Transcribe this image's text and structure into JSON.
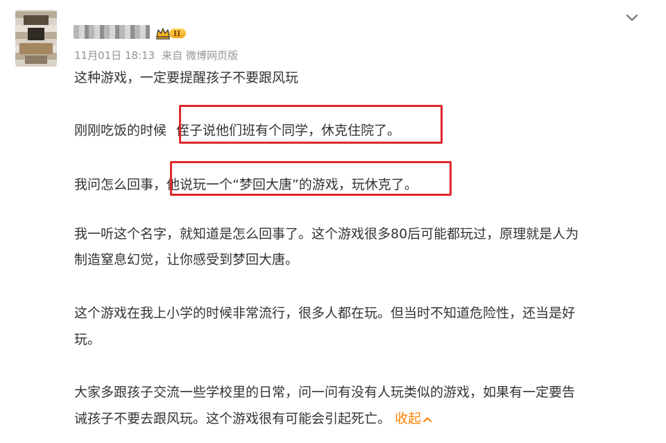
{
  "post": {
    "timestamp": "11月01日 18:13",
    "source": "来自 微博网页版",
    "level_badge": "II",
    "icons": {
      "avatar": "avatar-image",
      "badge": "crown-icon",
      "menu": "chevron-down-icon",
      "collapse": "chevron-up-icon"
    },
    "paragraphs": {
      "p1": "这种游戏，一定要提醒孩子不要跟风玩",
      "p2_pre": "刚刚吃饭的时候",
      "p2_highlight": "侄子说他们班有个同学，休克住院了。",
      "p3_pre": "我问怎么回事，",
      "p3_highlight": "他说玩一个“梦回大唐”的游戏，玩休克了。",
      "p4_line1": "我一听这个名字，就知道是怎么回事了。这个游戏很多80后可能都玩过，原理就是人为",
      "p4_line2": "制造窒息幻觉，让你感受到梦回大唐。",
      "p5_line1": "这个游戏在我上小学的时候非常流行，很多人都在玩。但当时不知道危险性，还当是好",
      "p5_line2": "玩。",
      "p6_line1": "大家多跟孩子交流一些学校里的日常，问一问有没有人玩类似的游戏，如果有一定要告",
      "p6_line2": "诫孩子不要去跟风玩。这个游戏很有可能会引起死亡。"
    },
    "collapse_label": "收起"
  },
  "colors": {
    "highlight_border": "#e0262a",
    "link": "#ff8200",
    "meta_text": "#939393",
    "body_text": "#333333"
  }
}
